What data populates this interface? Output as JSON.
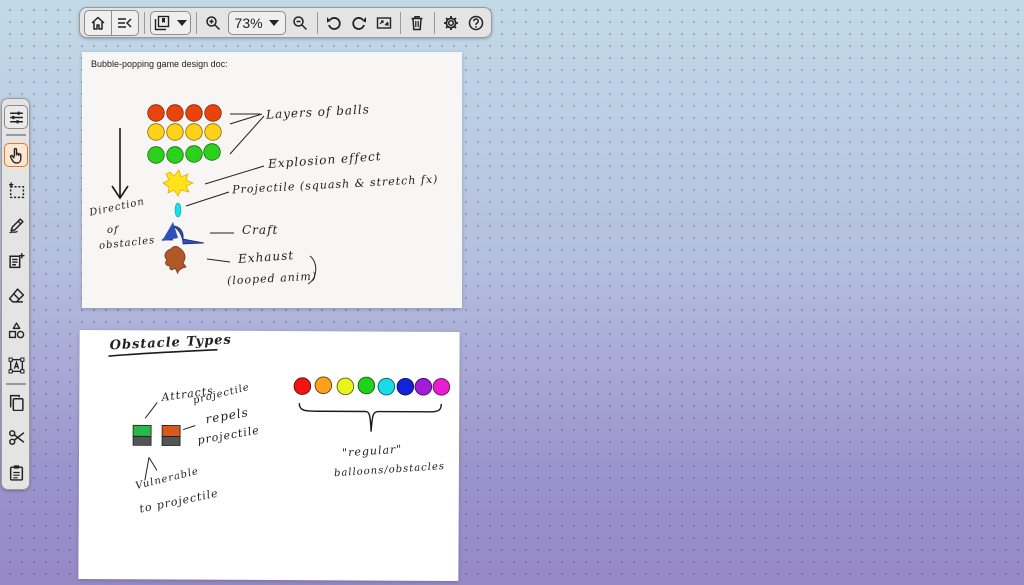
{
  "toolbar": {
    "zoom_value": "73%",
    "icons": [
      "home-icon",
      "slides-menu-icon",
      "page-layout-icon",
      "zoom-in-icon",
      "zoom-out-icon",
      "undo-icon",
      "redo-icon",
      "fit-screen-icon",
      "trash-icon",
      "settings-icon",
      "help-icon"
    ]
  },
  "left_toolbar": {
    "icons": [
      "sliders-icon",
      "pointer-hand-icon",
      "select-marquee-icon",
      "pen-icon",
      "add-text-icon",
      "eraser-icon",
      "shapes-icon",
      "text-box-icon",
      "copy-icon",
      "scissors-icon",
      "paste-icon"
    ]
  },
  "card1": {
    "title": "Bubble-popping game design doc:",
    "labels": {
      "layers": "Layers of balls",
      "explosion": "Explosion effect",
      "projectile": "Projectile (squash & stretch fx)",
      "direction_1": "Direction",
      "direction_2": "of",
      "direction_3": "obstacles",
      "craft": "Craft",
      "exhaust_1": "Exhaust",
      "exhaust_2": "(looped anim)"
    },
    "ball_colors": {
      "red": "#e8440c",
      "yellow": "#ffd21a",
      "green": "#2bd11c"
    }
  },
  "card2": {
    "title": "Obstacle Types",
    "labels": {
      "attracts_1": "Attracts",
      "attracts_2": "projectile",
      "repels_1": "repels",
      "repels_2": "projectile",
      "vulnerable_1": "Vulnerable",
      "vulnerable_2": "to projectile",
      "regular_1": "\"regular\"",
      "regular_2": "balloons/obstacles"
    },
    "balloon_colors": [
      "#f01414",
      "#ffa01c",
      "#e8f51c",
      "#21d11c",
      "#19dce8",
      "#1423d8",
      "#a31cd8",
      "#e81cd1"
    ]
  }
}
